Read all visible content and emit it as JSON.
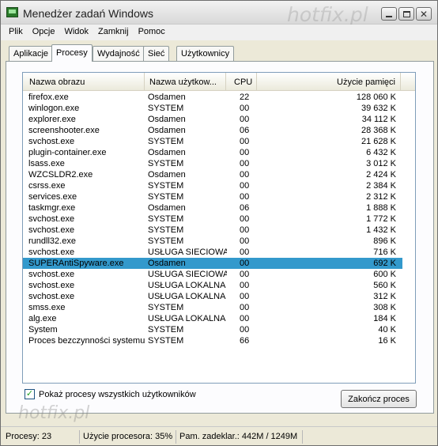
{
  "window": {
    "title": "Menedżer zadań Windows",
    "watermark_top": "hotfix.pl",
    "watermark_bottom": "hotfix.pl"
  },
  "menu": [
    "Plik",
    "Opcje",
    "Widok",
    "Zamknij",
    "Pomoc"
  ],
  "tabs": [
    "Aplikacje",
    "Procesy",
    "Wydajność",
    "Sieć",
    "Użytkownicy"
  ],
  "active_tab": "Procesy",
  "columns": [
    "Nazwa obrazu",
    "Nazwa użytkow...",
    "CPU",
    "Użycie pamięci"
  ],
  "processes": [
    {
      "name": "firefox.exe",
      "user": "Osdamen",
      "cpu": "22",
      "mem": "128 060 K"
    },
    {
      "name": "winlogon.exe",
      "user": "SYSTEM",
      "cpu": "00",
      "mem": "39 632 K"
    },
    {
      "name": "explorer.exe",
      "user": "Osdamen",
      "cpu": "00",
      "mem": "34 112 K"
    },
    {
      "name": "screenshooter.exe",
      "user": "Osdamen",
      "cpu": "06",
      "mem": "28 368 K"
    },
    {
      "name": "svchost.exe",
      "user": "SYSTEM",
      "cpu": "00",
      "mem": "21 628 K"
    },
    {
      "name": "plugin-container.exe",
      "user": "Osdamen",
      "cpu": "00",
      "mem": "6 432 K"
    },
    {
      "name": "lsass.exe",
      "user": "SYSTEM",
      "cpu": "00",
      "mem": "3 012 K"
    },
    {
      "name": "WZCSLDR2.exe",
      "user": "Osdamen",
      "cpu": "00",
      "mem": "2 424 K"
    },
    {
      "name": "csrss.exe",
      "user": "SYSTEM",
      "cpu": "00",
      "mem": "2 384 K"
    },
    {
      "name": "services.exe",
      "user": "SYSTEM",
      "cpu": "00",
      "mem": "2 312 K"
    },
    {
      "name": "taskmgr.exe",
      "user": "Osdamen",
      "cpu": "06",
      "mem": "1 888 K"
    },
    {
      "name": "svchost.exe",
      "user": "SYSTEM",
      "cpu": "00",
      "mem": "1 772 K"
    },
    {
      "name": "svchost.exe",
      "user": "SYSTEM",
      "cpu": "00",
      "mem": "1 432 K"
    },
    {
      "name": "rundll32.exe",
      "user": "SYSTEM",
      "cpu": "00",
      "mem": "896 K"
    },
    {
      "name": "svchost.exe",
      "user": "USŁUGA SIECIOWA",
      "cpu": "00",
      "mem": "716 K"
    },
    {
      "name": "SUPERAntiSpyware.exe",
      "user": "Osdamen",
      "cpu": "00",
      "mem": "692 K",
      "selected": true
    },
    {
      "name": "svchost.exe",
      "user": "USŁUGA SIECIOWA",
      "cpu": "00",
      "mem": "600 K"
    },
    {
      "name": "svchost.exe",
      "user": "USŁUGA LOKALNA",
      "cpu": "00",
      "mem": "560 K"
    },
    {
      "name": "svchost.exe",
      "user": "USŁUGA LOKALNA",
      "cpu": "00",
      "mem": "312 K"
    },
    {
      "name": "smss.exe",
      "user": "SYSTEM",
      "cpu": "00",
      "mem": "308 K"
    },
    {
      "name": "alg.exe",
      "user": "USŁUGA LOKALNA",
      "cpu": "00",
      "mem": "184 K"
    },
    {
      "name": "System",
      "user": "SYSTEM",
      "cpu": "00",
      "mem": "40 K"
    },
    {
      "name": "Proces bezczynności systemu",
      "user": "SYSTEM",
      "cpu": "66",
      "mem": "16 K"
    }
  ],
  "show_all_label": "Pokaż procesy wszystkich użytkowników",
  "show_all_checked": true,
  "end_process_label": "Zakończ proces",
  "status": {
    "processes": "Procesy: 23",
    "cpu": "Użycie procesora: 35%",
    "commit": "Pam. zadeklar.: 442M / 1249M"
  },
  "colors": {
    "selection": "#3399cc",
    "face": "#ece9d8"
  }
}
